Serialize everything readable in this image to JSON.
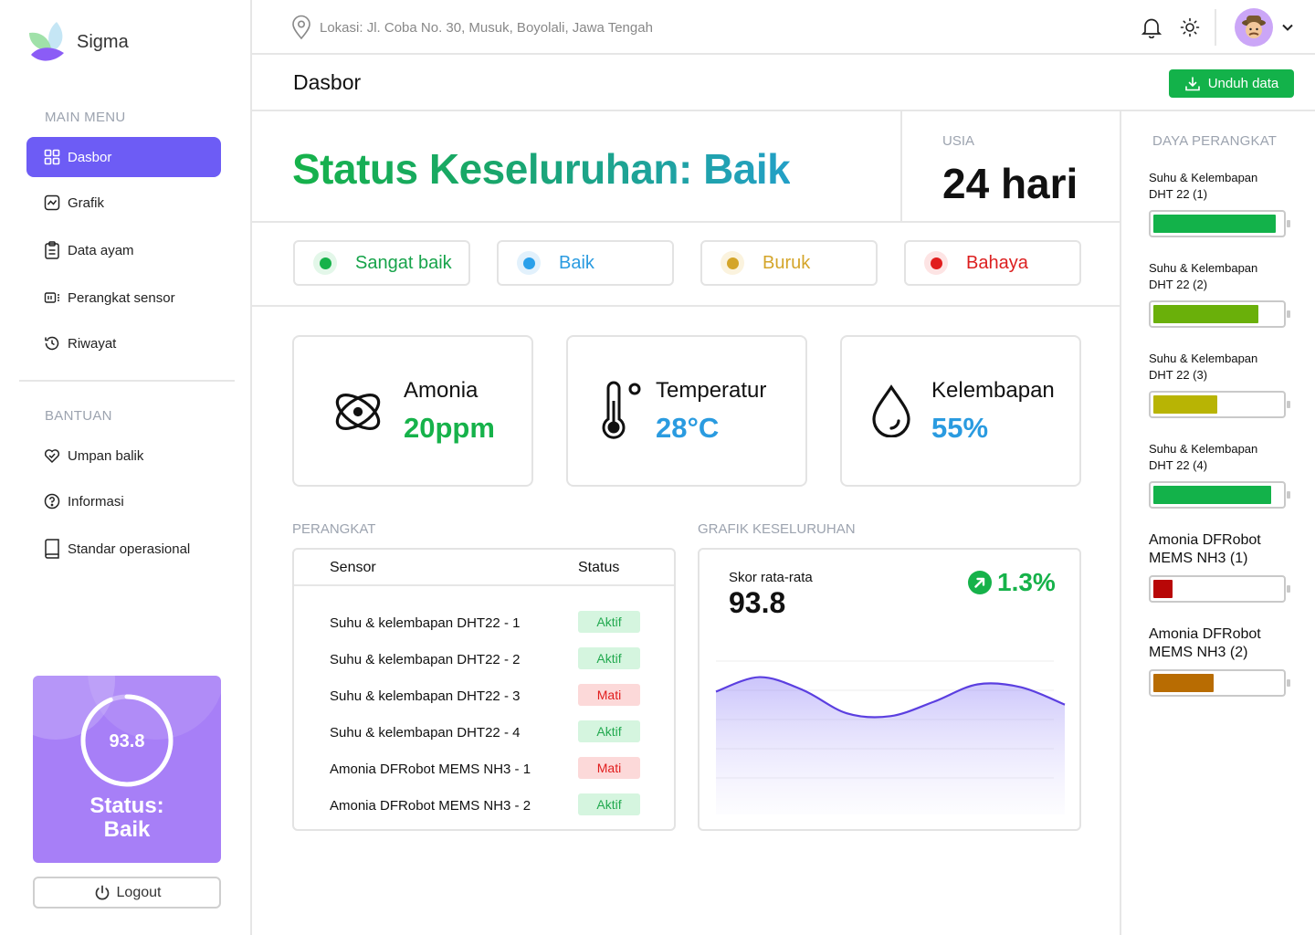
{
  "app": {
    "name": "Sigma"
  },
  "sidebar": {
    "main_menu_label": "MAIN MENU",
    "main_items": [
      {
        "label": "Dasbor",
        "icon": "grid-icon",
        "active": true
      },
      {
        "label": "Grafik",
        "icon": "chart-icon"
      },
      {
        "label": "Data ayam",
        "icon": "clipboard-icon"
      },
      {
        "label": "Perangkat sensor",
        "icon": "device-icon"
      },
      {
        "label": "Riwayat",
        "icon": "history-icon"
      }
    ],
    "help_label": "BANTUAN",
    "help_items": [
      {
        "label": "Umpan balik",
        "icon": "feedback-icon"
      },
      {
        "label": "Informasi",
        "icon": "question-icon"
      },
      {
        "label": "Standar operasional",
        "icon": "book-icon"
      }
    ],
    "score_card": {
      "value": "93.8",
      "progress": 0.938,
      "status_line1": "Status:",
      "status_line2": "Baik"
    },
    "logout_label": "Logout"
  },
  "header": {
    "location": "Lokasi: Jl. Coba No.  30, Musuk, Boyolali, Jawa Tengah",
    "page_title": "Dasbor",
    "download_label": "Unduh data"
  },
  "overview": {
    "status_title": "Status Keseluruhan: Baik",
    "age_label": "USIA",
    "age_value": "24 hari"
  },
  "legend": [
    {
      "label": "Sangat baik",
      "color": "#16b24a",
      "text_color": "#16a34a",
      "glow": "#e3f7e9"
    },
    {
      "label": "Baik",
      "color": "#2aa0ea",
      "text_color": "#2a9be0",
      "glow": "#e2f1fc"
    },
    {
      "label": "Buruk",
      "color": "#d4a52a",
      "text_color": "#d4a52a",
      "glow": "#fbf3de"
    },
    {
      "label": "Bahaya",
      "color": "#e11d1d",
      "text_color": "#dc1f1f",
      "glow": "#fde4e4"
    }
  ],
  "metrics": [
    {
      "label": "Amonia",
      "value": "20ppm",
      "color": "#16b24a",
      "icon": "atom-icon"
    },
    {
      "label": "Temperatur",
      "value": "28°C",
      "color": "#2a9be0",
      "icon": "thermometer-icon"
    },
    {
      "label": "Kelembapan",
      "value": "55%",
      "color": "#2a9be0",
      "icon": "droplet-icon"
    }
  ],
  "devices_section": {
    "label": "PERANGKAT",
    "col_sensor": "Sensor",
    "col_status": "Status",
    "rows": [
      {
        "name": "Suhu & kelembapan DHT22 - 1",
        "status": "Aktif",
        "active": true
      },
      {
        "name": "Suhu & kelembapan DHT22 - 2",
        "status": "Aktif",
        "active": true
      },
      {
        "name": "Suhu & kelembapan DHT22 - 3",
        "status": "Mati",
        "active": false
      },
      {
        "name": "Suhu & kelembapan DHT22 - 4",
        "status": "Aktif",
        "active": true
      },
      {
        "name": "Amonia DFRobot MEMS NH3 - 1",
        "status": "Mati",
        "active": false
      },
      {
        "name": "Amonia DFRobot MEMS NH3 - 2",
        "status": "Aktif",
        "active": true
      }
    ]
  },
  "overall_chart": {
    "label": "GRAFIK KESELURUHAN",
    "avg_label": "Skor rata-rata",
    "avg_value": "93.8",
    "trend": "1.3%",
    "line_color": "#5b3fe0"
  },
  "chart_data": {
    "type": "area",
    "title": "",
    "xlabel": "",
    "ylabel": "",
    "x": [
      0,
      1,
      2,
      3,
      4,
      5,
      6,
      7,
      8
    ],
    "values": [
      94.5,
      95.5,
      94.6,
      93.0,
      92.8,
      93.8,
      95.0,
      94.8,
      93.6
    ],
    "ylim": [
      86,
      98
    ],
    "grid": true
  },
  "power_panel": {
    "title": "DAYA PERANGKAT",
    "devices": [
      {
        "line1": "Suhu & Kelembapan",
        "line2": "DHT 22 (1)",
        "level": 0.96,
        "color": "#13b24a",
        "big": false
      },
      {
        "line1": "Suhu & Kelembapan",
        "line2": "DHT 22 (2)",
        "level": 0.82,
        "color": "#6ab00a",
        "big": false
      },
      {
        "line1": "Suhu & Kelembapan",
        "line2": "DHT 22 (3)",
        "level": 0.5,
        "color": "#b8b404",
        "big": false
      },
      {
        "line1": "Suhu & Kelembapan",
        "line2": "DHT 22 (4)",
        "level": 0.92,
        "color": "#13b24a",
        "big": false
      },
      {
        "line1": "Amonia DFRobot",
        "line2": "MEMS NH3 (1)",
        "level": 0.15,
        "color": "#b80707",
        "big": true
      },
      {
        "line1": "Amonia DFRobot",
        "line2": "MEMS NH3 (2)",
        "level": 0.47,
        "color": "#b86c02",
        "big": true
      }
    ]
  }
}
